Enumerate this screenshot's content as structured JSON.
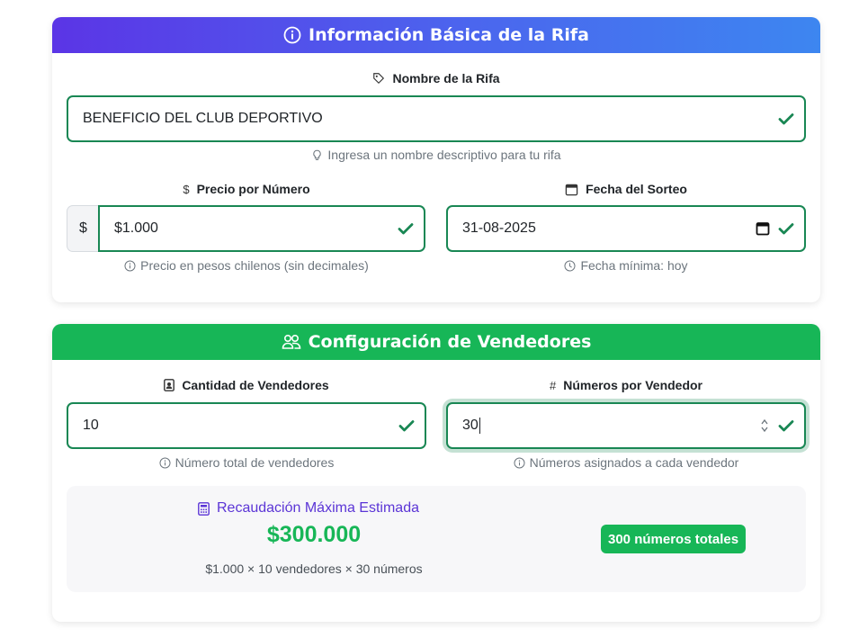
{
  "basic_section": {
    "title": "Información Básica de la Rifa",
    "name_label": "Nombre de la Rifa",
    "name_value": "BENEFICIO DEL CLUB DEPORTIVO",
    "name_hint": "Ingresa un nombre descriptivo para tu rifa",
    "price_label": "Precio por Número",
    "price_symbol": "$",
    "price_value": "$1.000",
    "price_hint": "Precio en pesos chilenos (sin decimales)",
    "date_label": "Fecha del Sorteo",
    "date_value": "31-08-2025",
    "date_hint": "Fecha mínima: hoy"
  },
  "sellers_section": {
    "title": "Configuración de Vendedores",
    "count_label": "Cantidad de Vendedores",
    "count_value": "10",
    "count_hint": "Número total de vendedores",
    "per_seller_label": "Números por Vendedor",
    "per_seller_symbol": "#",
    "per_seller_value": "30",
    "per_seller_hint": "Números asignados a cada vendedor"
  },
  "summary": {
    "title": "Recaudación Máxima Estimada",
    "amount": "$300.000",
    "formula": "$1.000 × 10 vendedores × 30 números",
    "badge": "300 números totales"
  },
  "colors": {
    "valid_green": "#198754",
    "accent_green": "#17b657",
    "header_gradient_start": "#5b35e6",
    "header_gradient_end": "#3d86f0",
    "summary_title": "#5b35d6"
  },
  "icons": {
    "basic_header": "info-circle-icon",
    "name": "tag-icon",
    "name_hint": "lightbulb-icon",
    "price": "dollar-icon",
    "date": "calendar-icon",
    "date_hint": "clock-icon",
    "sellers_header": "people-icon",
    "count": "person-badge-icon",
    "per_seller": "hash-icon",
    "hint": "info-circle-icon",
    "summary": "calculator-icon",
    "valid": "check-icon"
  }
}
